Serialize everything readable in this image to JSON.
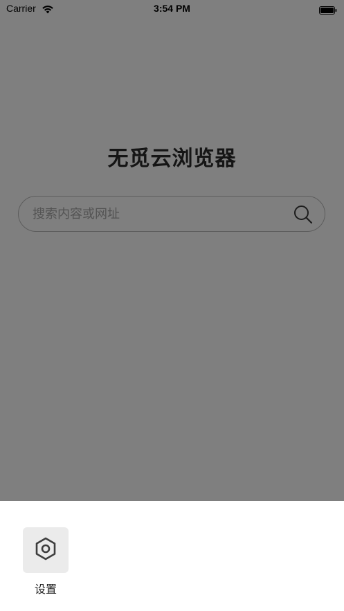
{
  "status_bar": {
    "carrier": "Carrier",
    "time": "3:54 PM",
    "wifi_icon": "wifi-icon",
    "battery_icon": "battery-icon"
  },
  "main": {
    "title": "无觅云浏览器",
    "search": {
      "placeholder": "搜索内容或网址",
      "value": "",
      "icon": "search-icon"
    }
  },
  "sheet": {
    "items": [
      {
        "label": "设置",
        "icon": "gear-icon"
      }
    ]
  },
  "colors": {
    "overlay": "#808080",
    "sheet_background": "#ffffff",
    "icon_tile": "#ebebeb",
    "title": "#2a2a2a"
  }
}
